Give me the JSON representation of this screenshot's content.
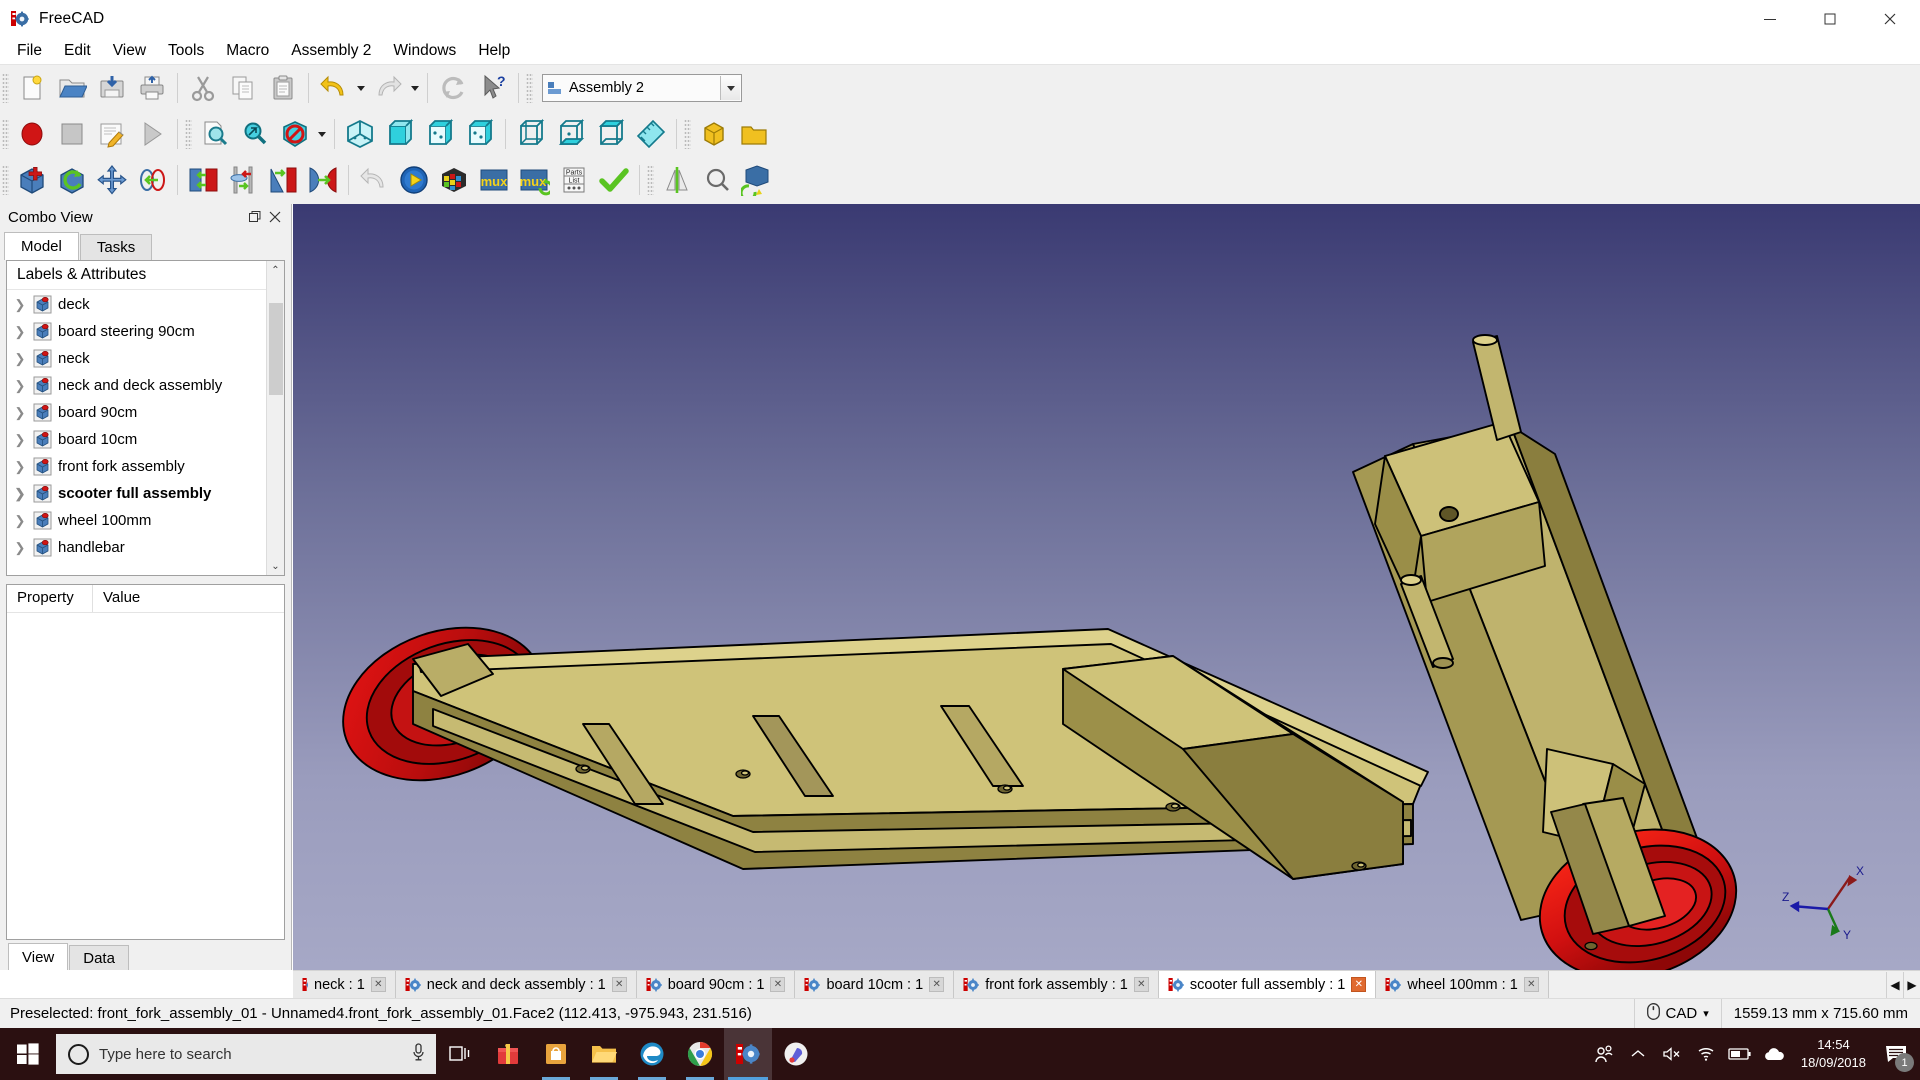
{
  "window": {
    "title": "FreeCAD",
    "icon": "freecad-icon",
    "minimize_label": "—",
    "maximize_label": "❐",
    "close_label": "✕"
  },
  "menubar": {
    "items": [
      {
        "label": "File"
      },
      {
        "label": "Edit"
      },
      {
        "label": "View"
      },
      {
        "label": "Tools"
      },
      {
        "label": "Macro"
      },
      {
        "label": "Assembly 2"
      },
      {
        "label": "Windows"
      },
      {
        "label": "Help"
      }
    ]
  },
  "workbench": {
    "selected": "Assembly 2"
  },
  "toolbars": {
    "file": [
      "new-document-icon",
      "open-document-icon",
      "save-document-icon",
      "print-document-icon"
    ],
    "edit": [
      "cut-icon",
      "copy-icon",
      "paste-icon",
      "undo-icon",
      "redo-icon",
      "refresh-icon",
      "whats-this-icon"
    ],
    "macro": [
      "macro-record-icon",
      "macro-stop-icon",
      "macros-dialog-icon",
      "execute-macro-icon"
    ],
    "view": [
      "fit-all-icon",
      "fit-selection-icon",
      "draw-style-icon"
    ],
    "std_views": [
      "isometric-view-icon",
      "front-view-icon",
      "top-view-icon",
      "right-view-icon",
      "rear-view-icon",
      "bottom-view-icon",
      "left-view-icon",
      "measure-icon"
    ],
    "structure": [
      "create-part-icon",
      "create-group-icon"
    ],
    "assembly": [
      "import-part-icon",
      "update-parts-icon",
      "move-part-icon",
      "axial-constraint-icon",
      "plane-constraint-icon",
      "circular-edge-constraint-icon",
      "angle-constraint-icon",
      "spherical-constraint-icon",
      "undo-constraint-icon",
      "solve-constraints-icon",
      "mux-assembly-icon",
      "mux-icon",
      "mux-refresh-icon",
      "parts-list-icon",
      "check-assembly-icon",
      "mirror-part-icon",
      "search-constraint-icon",
      "degrees-of-freedom-icon"
    ]
  },
  "combo_view": {
    "title": "Combo View",
    "float_label": "❐",
    "close_label": "✕",
    "tabs": [
      {
        "label": "Model",
        "active": true
      },
      {
        "label": "Tasks",
        "active": false
      }
    ],
    "tree": {
      "header": "Labels & Attributes",
      "items": [
        {
          "label": "deck",
          "bold": false
        },
        {
          "label": "board steering 90cm",
          "bold": false
        },
        {
          "label": "neck",
          "bold": false
        },
        {
          "label": "neck and deck assembly",
          "bold": false
        },
        {
          "label": "board 90cm",
          "bold": false
        },
        {
          "label": "board 10cm",
          "bold": false
        },
        {
          "label": "front fork assembly",
          "bold": false
        },
        {
          "label": "scooter full assembly",
          "bold": true
        },
        {
          "label": "wheel 100mm",
          "bold": false
        },
        {
          "label": "handlebar",
          "bold": false
        }
      ],
      "scroll_up": "⌃",
      "scroll_down": "⌄"
    },
    "property_editor": {
      "columns": [
        "Property",
        "Value"
      ],
      "rows": []
    },
    "bottom_tabs": [
      {
        "label": "View",
        "active": true
      },
      {
        "label": "Data",
        "active": false
      }
    ]
  },
  "viewport": {
    "axis_labels": {
      "x": "X",
      "y": "Y",
      "z": "Z"
    },
    "axis_colors": {
      "x": "#8b1a1a",
      "y": "#1a7a1a",
      "z": "#1a1aa8"
    },
    "model_colors": {
      "wood_light": "#cfc379",
      "wood_mid": "#a89c55",
      "wood_dark": "#8c8040",
      "wheel_red": "#e01515",
      "wheel_red_dark": "#9b0d0d",
      "outline": "#000000"
    },
    "background_top": "#3a3a72",
    "background_bottom": "#a6a8c6"
  },
  "document_tabs": {
    "items": [
      {
        "label": "neck : 1",
        "active": false,
        "clipped": true
      },
      {
        "label": "neck and deck assembly : 1",
        "active": false
      },
      {
        "label": "board 90cm : 1",
        "active": false
      },
      {
        "label": "board 10cm : 1",
        "active": false
      },
      {
        "label": "front fork assembly : 1",
        "active": false
      },
      {
        "label": "scooter full assembly : 1",
        "active": true
      },
      {
        "label": "wheel 100mm : 1",
        "active": false
      }
    ],
    "close_label": "✕",
    "nav_prev": "◀",
    "nav_next": "▶"
  },
  "statusbar": {
    "message": "Preselected: front_fork_assembly_01 - Unnamed4.front_fork_assembly_01.Face2 (112.413, -975.943, 231.516)",
    "nav_style": "CAD",
    "nav_style_icon": "mouse-icon",
    "nav_caret": "▾",
    "dimensions": "1559.13 mm x 715.60 mm"
  },
  "taskbar": {
    "start_icon": "windows-start-icon",
    "search_placeholder": "Type here to search",
    "cortana_icon": "cortana-ring-icon",
    "mic_icon": "microphone-icon",
    "task_view_icon": "task-view-icon",
    "pinned": [
      {
        "name": "store-gift-icon"
      },
      {
        "name": "microsoft-store-icon"
      },
      {
        "name": "file-explorer-icon"
      },
      {
        "name": "edge-browser-icon"
      },
      {
        "name": "chrome-browser-icon"
      },
      {
        "name": "freecad-app-icon",
        "active": true
      },
      {
        "name": "paint3d-icon"
      }
    ],
    "tray": [
      {
        "name": "people-icon"
      },
      {
        "name": "show-hidden-icons-icon"
      },
      {
        "name": "volume-muted-icon"
      },
      {
        "name": "wifi-icon"
      },
      {
        "name": "battery-icon"
      },
      {
        "name": "onedrive-icon"
      }
    ],
    "clock_time": "14:54",
    "clock_date": "18/09/2018",
    "notification_icon": "action-center-icon",
    "notification_count": "1"
  }
}
